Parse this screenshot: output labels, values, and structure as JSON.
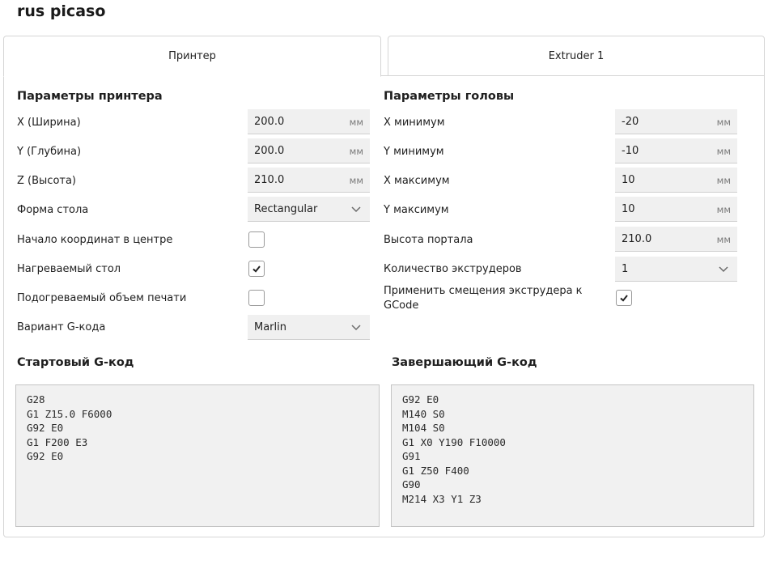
{
  "title": "rus picaso",
  "tabs": [
    {
      "label": "Принтер",
      "active": true
    },
    {
      "label": "Extruder 1",
      "active": false
    }
  ],
  "printer": {
    "section_title": "Параметры принтера",
    "x_label": "X (Ширина)",
    "x_value": "200.0",
    "x_unit": "мм",
    "y_label": "Y (Глубина)",
    "y_value": "200.0",
    "y_unit": "мм",
    "z_label": "Z (Высота)",
    "z_value": "210.0",
    "z_unit": "мм",
    "bed_shape_label": "Форма стола",
    "bed_shape_value": "Rectangular",
    "origin_center_label": "Начало координат в центре",
    "origin_center_checked": false,
    "heated_bed_label": "Нагреваемый стол",
    "heated_bed_checked": true,
    "heated_volume_label": "Подогреваемый объем печати",
    "heated_volume_checked": false,
    "gcode_flavor_label": "Вариант G-кода",
    "gcode_flavor_value": "Marlin"
  },
  "head": {
    "section_title": "Параметры головы",
    "xmin_label": "X минимум",
    "xmin_value": "-20",
    "xmin_unit": "мм",
    "ymin_label": "Y минимум",
    "ymin_value": "-10",
    "ymin_unit": "мм",
    "xmax_label": "X максимум",
    "xmax_value": "10",
    "xmax_unit": "мм",
    "ymax_label": "Y максимум",
    "ymax_value": "10",
    "ymax_unit": "мм",
    "gantry_label": "Высота портала",
    "gantry_value": "210.0",
    "gantry_unit": "мм",
    "extruder_count_label": "Количество экструдеров",
    "extruder_count_value": "1",
    "apply_offsets_label": "Применить смещения экструдера к GCode",
    "apply_offsets_checked": true
  },
  "start_gcode": {
    "title": "Стартовый G-код",
    "text": "G28\nG1 Z15.0 F6000\nG92 E0\nG1 F200 E3\nG92 E0"
  },
  "end_gcode": {
    "title": "Завершающий G-код",
    "text": "G92 E0\nM140 S0\nM104 S0\nG1 X0 Y190 F10000\nG91\nG1 Z50 F400\nG90\nM214 X3 Y1 Z3"
  },
  "colors": {
    "field_bg": "#f0f0f0",
    "border": "#d6d6d6",
    "text": "#1f1f1f"
  }
}
